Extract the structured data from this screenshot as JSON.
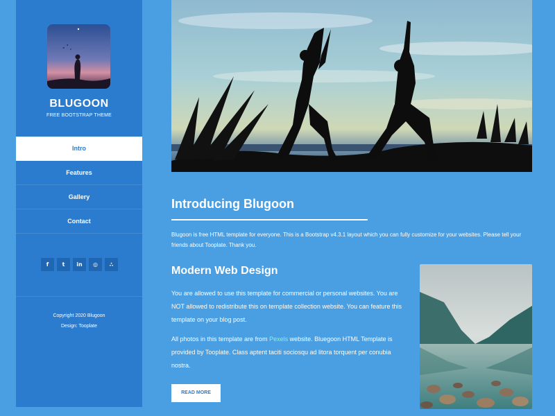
{
  "sidebar": {
    "brand": "BLUGOON",
    "tagline": "FREE BOOTSTRAP THEME",
    "nav": [
      {
        "label": "Intro",
        "active": true
      },
      {
        "label": "Features",
        "active": false
      },
      {
        "label": "Gallery",
        "active": false
      },
      {
        "label": "Contact",
        "active": false
      }
    ],
    "social": [
      {
        "icon": "facebook-icon",
        "glyph": "f"
      },
      {
        "icon": "twitter-icon",
        "glyph": "t"
      },
      {
        "icon": "linkedin-icon",
        "glyph": "in"
      },
      {
        "icon": "dribbble-icon",
        "glyph": "◎"
      },
      {
        "icon": "rss-icon",
        "glyph": "∴"
      }
    ],
    "copyright": "Copyright 2020 Blugoon",
    "design": "Design: Tooplate"
  },
  "main": {
    "intro_title": "Introducing Blugoon",
    "intro_text": "Blugoon is free HTML template for everyone. This is a Bootstrap v4.3.1 layout which you can fully customize for your websites. Please tell your friends about Tooplate. Thank you.",
    "section_title": "Modern Web Design",
    "para1": "You are allowed to use this template for commercial or personal websites. You are NOT allowed to redistribute this on template collection website. You can feature this template on your blog post.",
    "para2_before": "All photos in this template are from ",
    "para2_link": "Pexels",
    "para2_after": " website. Bluegoon HTML Template is provided by Tooplate. Class aptent taciti sociosqu ad litora torquent per conubia nostra.",
    "read_more": "READ MORE"
  },
  "colors": {
    "page_bg": "#4a9ee2",
    "sidebar_bg": "#2b7bcf",
    "social_bg": "#1f67b3",
    "link": "#8ff0d8"
  }
}
